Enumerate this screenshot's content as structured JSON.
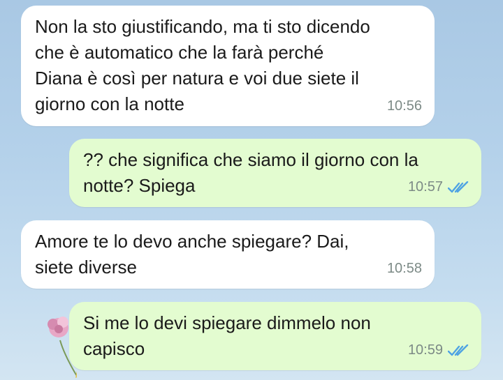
{
  "chat": {
    "messages": [
      {
        "direction": "incoming",
        "text": "Non la sto giustificando, ma ti sto dicendo\nche è automatico che la farà perché\nDiana è così per natura e voi due siete il\ngiorno con la notte",
        "time": "10:56"
      },
      {
        "direction": "outgoing",
        "text": "?? che significa che siamo il giorno con la\nnotte? Spiega",
        "time": "10:57",
        "status": "read"
      },
      {
        "direction": "incoming",
        "text": "Amore te lo devo anche spiegare? Dai,\nsiete diverse",
        "time": "10:58"
      },
      {
        "direction": "outgoing",
        "text": "Si me lo devi spiegare dimmelo non\ncapisco",
        "time": "10:59",
        "status": "read"
      }
    ]
  },
  "icons": {
    "read_receipt": "double-check-icon"
  },
  "colors": {
    "incoming_bubble": "#ffffff",
    "outgoing_bubble": "#e3fcd0",
    "read_ticks": "#4fa3e3",
    "timestamp": "#7c8a86"
  }
}
